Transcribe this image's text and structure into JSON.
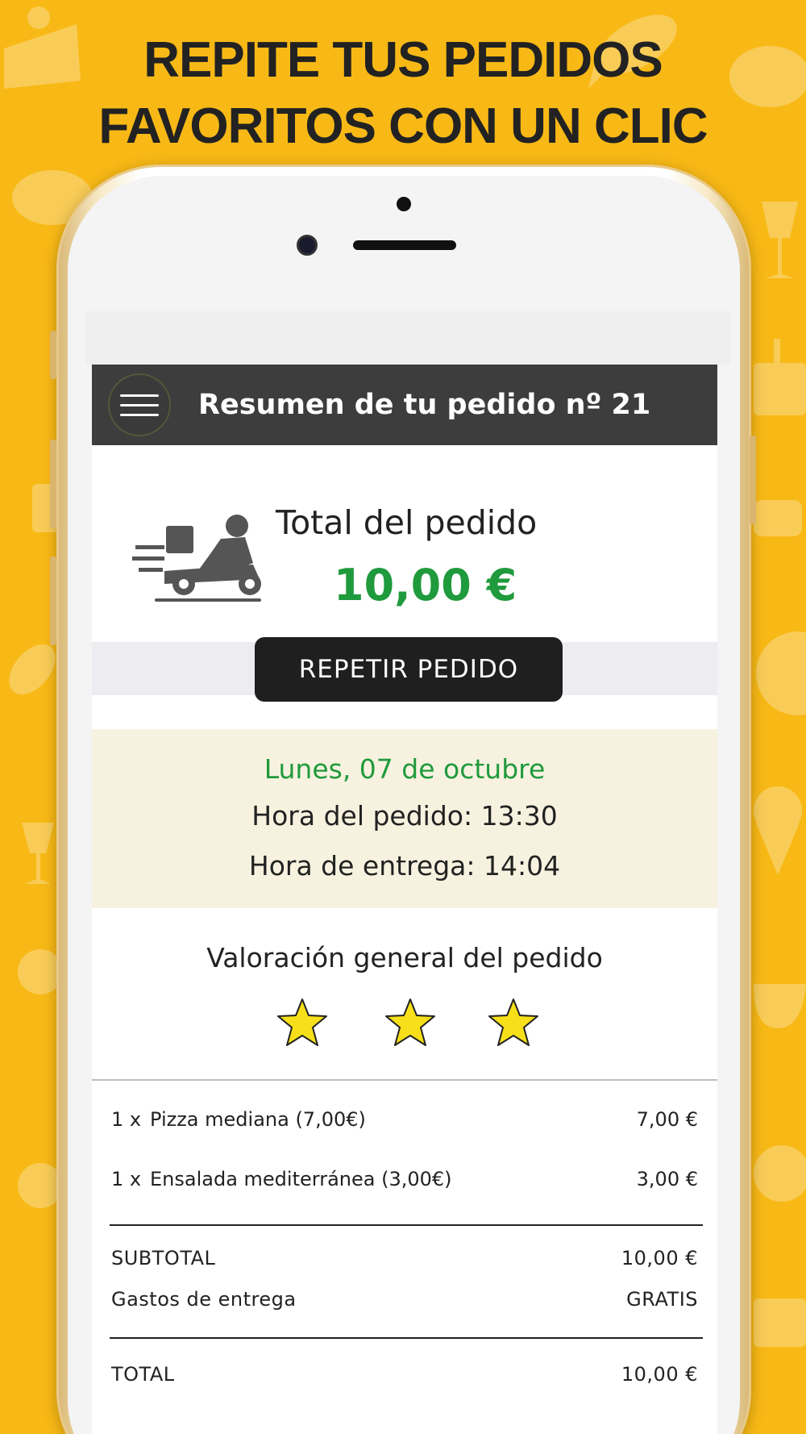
{
  "headline": {
    "line1": "REPITE TUS PEDIDOS",
    "line2": "FAVORITOS CON UN CLIC"
  },
  "header": {
    "title": "Resumen de tu pedido nº 21",
    "menu_icon": "hamburger-menu-icon"
  },
  "summary": {
    "icon": "delivery-scooter-icon",
    "total_label": "Total del pedido",
    "total_value": "10,00 €",
    "repeat_button": "REPETIR PEDIDO"
  },
  "schedule": {
    "date": "Lunes, 07 de octubre",
    "order_time": "Hora del pedido: 13:30",
    "delivery_time": "Hora de entrega: 14:04"
  },
  "rating": {
    "title": "Valoración general del pedido",
    "stars": 3
  },
  "items": [
    {
      "qty": "1 x",
      "name": "Pizza mediana (7,00€)",
      "price": "7,00 €"
    },
    {
      "qty": "1 x",
      "name": "Ensalada mediterránea (3,00€)",
      "price": "3,00 €"
    }
  ],
  "totals": {
    "subtotal_label": "SUBTOTAL",
    "subtotal_value": "10,00 €",
    "delivery_label": "Gastos de entrega",
    "delivery_value": "GRATIS",
    "total_label": "TOTAL",
    "total_value": "10,00 €"
  },
  "colors": {
    "background": "#f8b916",
    "header": "#3d3d3d",
    "accent_green": "#1f9a3c",
    "star": "#f7e01a"
  }
}
